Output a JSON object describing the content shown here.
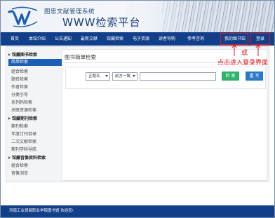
{
  "header": {
    "subtitle": "图思文献管理系统",
    "title": "WWW检索平台"
  },
  "nav": {
    "items": [
      "首页",
      "本馆介绍",
      "公告通知",
      "最新文献",
      "馆藏检索",
      "电子资源",
      "读者导购",
      "参考咨询",
      "我的图书馆",
      "登录"
    ]
  },
  "sidebar": {
    "groups": [
      {
        "label": "馆藏图书检索",
        "items": [
          "简单检索",
          "组合检索",
          "题名检索",
          "作者检索",
          "分类引导",
          "系列码检索",
          "关联资源检索"
        ]
      },
      {
        "label": "馆藏期刊检索",
        "items": [
          "期刊检索",
          "年度订刊目录",
          "二次文献检索",
          "期刊学科导航"
        ]
      },
      {
        "label": "馆藏音像资料检索",
        "items": [
          "组合检索",
          "音像浏览"
        ]
      }
    ],
    "active_item": "简单检索"
  },
  "main": {
    "title": "图书简单检索",
    "field_select": "正题名",
    "match_select": "前方一致",
    "query_value": "",
    "search_button": "检 索",
    "reset_button": "重 写"
  },
  "annotations": {
    "or_text": "或",
    "hint_text": "点击进入登录界面"
  },
  "footer": {
    "text": "河南工业贸易职业学院图书馆 欢迎您!"
  },
  "colors": {
    "nav_bg": "#123f8a",
    "active_item_bg": "#1a5fb4",
    "search_button_bg": "#2fb36a",
    "reset_button_bg": "#2a79c9",
    "annotation_red": "#e0161b"
  }
}
